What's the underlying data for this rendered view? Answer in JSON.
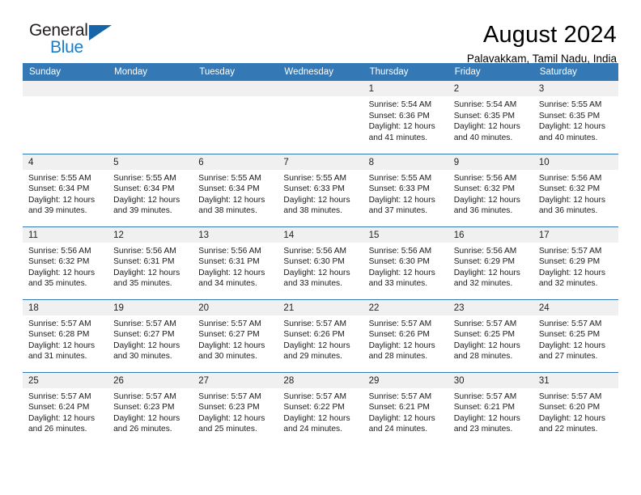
{
  "brand": {
    "name_part1": "General",
    "name_part2": "Blue",
    "accent_color": "#1a7cc7",
    "triangle_color": "#1565a8"
  },
  "header": {
    "month_title": "August 2024",
    "location": "Palavakkam, Tamil Nadu, India"
  },
  "calendar": {
    "header_color": "#3479b5",
    "weekday_headers": [
      "Sunday",
      "Monday",
      "Tuesday",
      "Wednesday",
      "Thursday",
      "Friday",
      "Saturday"
    ],
    "weeks": [
      [
        {
          "date": "",
          "details": ""
        },
        {
          "date": "",
          "details": ""
        },
        {
          "date": "",
          "details": ""
        },
        {
          "date": "",
          "details": ""
        },
        {
          "date": "1",
          "details": "Sunrise: 5:54 AM\nSunset: 6:36 PM\nDaylight: 12 hours\nand 41 minutes."
        },
        {
          "date": "2",
          "details": "Sunrise: 5:54 AM\nSunset: 6:35 PM\nDaylight: 12 hours\nand 40 minutes."
        },
        {
          "date": "3",
          "details": "Sunrise: 5:55 AM\nSunset: 6:35 PM\nDaylight: 12 hours\nand 40 minutes."
        }
      ],
      [
        {
          "date": "4",
          "details": "Sunrise: 5:55 AM\nSunset: 6:34 PM\nDaylight: 12 hours\nand 39 minutes."
        },
        {
          "date": "5",
          "details": "Sunrise: 5:55 AM\nSunset: 6:34 PM\nDaylight: 12 hours\nand 39 minutes."
        },
        {
          "date": "6",
          "details": "Sunrise: 5:55 AM\nSunset: 6:34 PM\nDaylight: 12 hours\nand 38 minutes."
        },
        {
          "date": "7",
          "details": "Sunrise: 5:55 AM\nSunset: 6:33 PM\nDaylight: 12 hours\nand 38 minutes."
        },
        {
          "date": "8",
          "details": "Sunrise: 5:55 AM\nSunset: 6:33 PM\nDaylight: 12 hours\nand 37 minutes."
        },
        {
          "date": "9",
          "details": "Sunrise: 5:56 AM\nSunset: 6:32 PM\nDaylight: 12 hours\nand 36 minutes."
        },
        {
          "date": "10",
          "details": "Sunrise: 5:56 AM\nSunset: 6:32 PM\nDaylight: 12 hours\nand 36 minutes."
        }
      ],
      [
        {
          "date": "11",
          "details": "Sunrise: 5:56 AM\nSunset: 6:32 PM\nDaylight: 12 hours\nand 35 minutes."
        },
        {
          "date": "12",
          "details": "Sunrise: 5:56 AM\nSunset: 6:31 PM\nDaylight: 12 hours\nand 35 minutes."
        },
        {
          "date": "13",
          "details": "Sunrise: 5:56 AM\nSunset: 6:31 PM\nDaylight: 12 hours\nand 34 minutes."
        },
        {
          "date": "14",
          "details": "Sunrise: 5:56 AM\nSunset: 6:30 PM\nDaylight: 12 hours\nand 33 minutes."
        },
        {
          "date": "15",
          "details": "Sunrise: 5:56 AM\nSunset: 6:30 PM\nDaylight: 12 hours\nand 33 minutes."
        },
        {
          "date": "16",
          "details": "Sunrise: 5:56 AM\nSunset: 6:29 PM\nDaylight: 12 hours\nand 32 minutes."
        },
        {
          "date": "17",
          "details": "Sunrise: 5:57 AM\nSunset: 6:29 PM\nDaylight: 12 hours\nand 32 minutes."
        }
      ],
      [
        {
          "date": "18",
          "details": "Sunrise: 5:57 AM\nSunset: 6:28 PM\nDaylight: 12 hours\nand 31 minutes."
        },
        {
          "date": "19",
          "details": "Sunrise: 5:57 AM\nSunset: 6:27 PM\nDaylight: 12 hours\nand 30 minutes."
        },
        {
          "date": "20",
          "details": "Sunrise: 5:57 AM\nSunset: 6:27 PM\nDaylight: 12 hours\nand 30 minutes."
        },
        {
          "date": "21",
          "details": "Sunrise: 5:57 AM\nSunset: 6:26 PM\nDaylight: 12 hours\nand 29 minutes."
        },
        {
          "date": "22",
          "details": "Sunrise: 5:57 AM\nSunset: 6:26 PM\nDaylight: 12 hours\nand 28 minutes."
        },
        {
          "date": "23",
          "details": "Sunrise: 5:57 AM\nSunset: 6:25 PM\nDaylight: 12 hours\nand 28 minutes."
        },
        {
          "date": "24",
          "details": "Sunrise: 5:57 AM\nSunset: 6:25 PM\nDaylight: 12 hours\nand 27 minutes."
        }
      ],
      [
        {
          "date": "25",
          "details": "Sunrise: 5:57 AM\nSunset: 6:24 PM\nDaylight: 12 hours\nand 26 minutes."
        },
        {
          "date": "26",
          "details": "Sunrise: 5:57 AM\nSunset: 6:23 PM\nDaylight: 12 hours\nand 26 minutes."
        },
        {
          "date": "27",
          "details": "Sunrise: 5:57 AM\nSunset: 6:23 PM\nDaylight: 12 hours\nand 25 minutes."
        },
        {
          "date": "28",
          "details": "Sunrise: 5:57 AM\nSunset: 6:22 PM\nDaylight: 12 hours\nand 24 minutes."
        },
        {
          "date": "29",
          "details": "Sunrise: 5:57 AM\nSunset: 6:21 PM\nDaylight: 12 hours\nand 24 minutes."
        },
        {
          "date": "30",
          "details": "Sunrise: 5:57 AM\nSunset: 6:21 PM\nDaylight: 12 hours\nand 23 minutes."
        },
        {
          "date": "31",
          "details": "Sunrise: 5:57 AM\nSunset: 6:20 PM\nDaylight: 12 hours\nand 22 minutes."
        }
      ]
    ]
  }
}
